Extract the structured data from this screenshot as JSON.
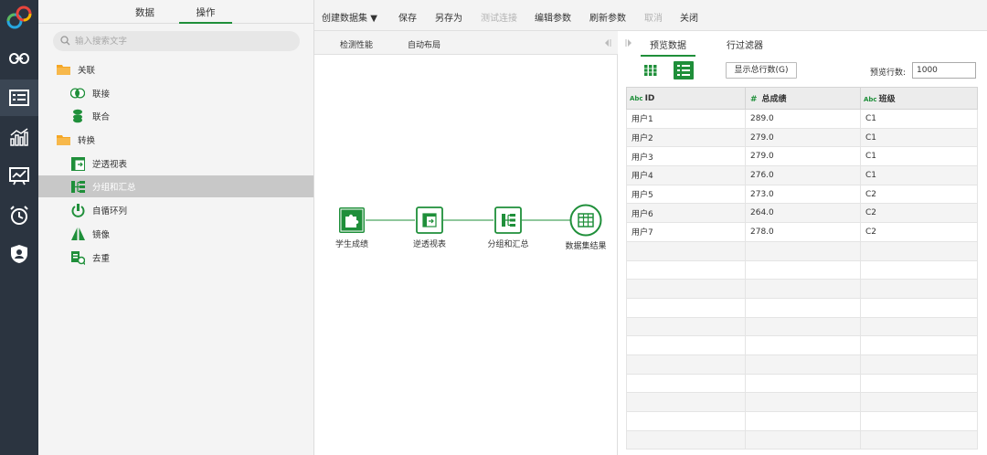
{
  "panel": {
    "tabs": [
      "数据",
      "操作"
    ],
    "search_placeholder": "输入搜索文字",
    "tree": [
      {
        "label": "关联",
        "type": "folder"
      },
      {
        "label": "联接",
        "type": "join"
      },
      {
        "label": "联合",
        "type": "union"
      },
      {
        "label": "转换",
        "type": "folder"
      },
      {
        "label": "逆透视表",
        "type": "unpivot"
      },
      {
        "label": "分组和汇总",
        "type": "group",
        "selected": true
      },
      {
        "label": "自循环列",
        "type": "loop"
      },
      {
        "label": "镜像",
        "type": "mirror"
      },
      {
        "label": "去重",
        "type": "dedupe"
      }
    ]
  },
  "toolbar": {
    "create_dataset": "创建数据集",
    "save": "保存",
    "save_as": "另存为",
    "test_connection": "测试连接",
    "edit_params": "编辑参数",
    "refresh_params": "刷新参数",
    "cancel": "取消",
    "close": "关闭"
  },
  "canvas": {
    "tabs": [
      "检测性能",
      "自动布局"
    ],
    "nodes": [
      {
        "label": "学生成绩",
        "icon": "puzzle-icon"
      },
      {
        "label": "逆透视表",
        "icon": "unpivot-icon"
      },
      {
        "label": "分组和汇总",
        "icon": "group-icon"
      },
      {
        "label": "数据集结果",
        "icon": "table-icon"
      }
    ]
  },
  "preview": {
    "tabs": [
      "预览数据",
      "行过滤器"
    ],
    "show_total_rows": "显示总行数(G)",
    "rows_label": "预览行数:",
    "rows_value": "1000",
    "columns": [
      {
        "name": "ID",
        "type": "Abc"
      },
      {
        "name": "总成绩",
        "type": "#"
      },
      {
        "name": "班级",
        "type": "Abc"
      }
    ],
    "rows": [
      [
        "用户1",
        "289.0",
        "C1"
      ],
      [
        "用户2",
        "279.0",
        "C1"
      ],
      [
        "用户3",
        "279.0",
        "C1"
      ],
      [
        "用户4",
        "276.0",
        "C1"
      ],
      [
        "用户5",
        "273.0",
        "C2"
      ],
      [
        "用户6",
        "264.0",
        "C2"
      ],
      [
        "用户7",
        "278.0",
        "C2"
      ]
    ]
  },
  "colors": {
    "accent": "#1f8f3a",
    "folder": "#f5a623",
    "rail": "#2b3440"
  }
}
